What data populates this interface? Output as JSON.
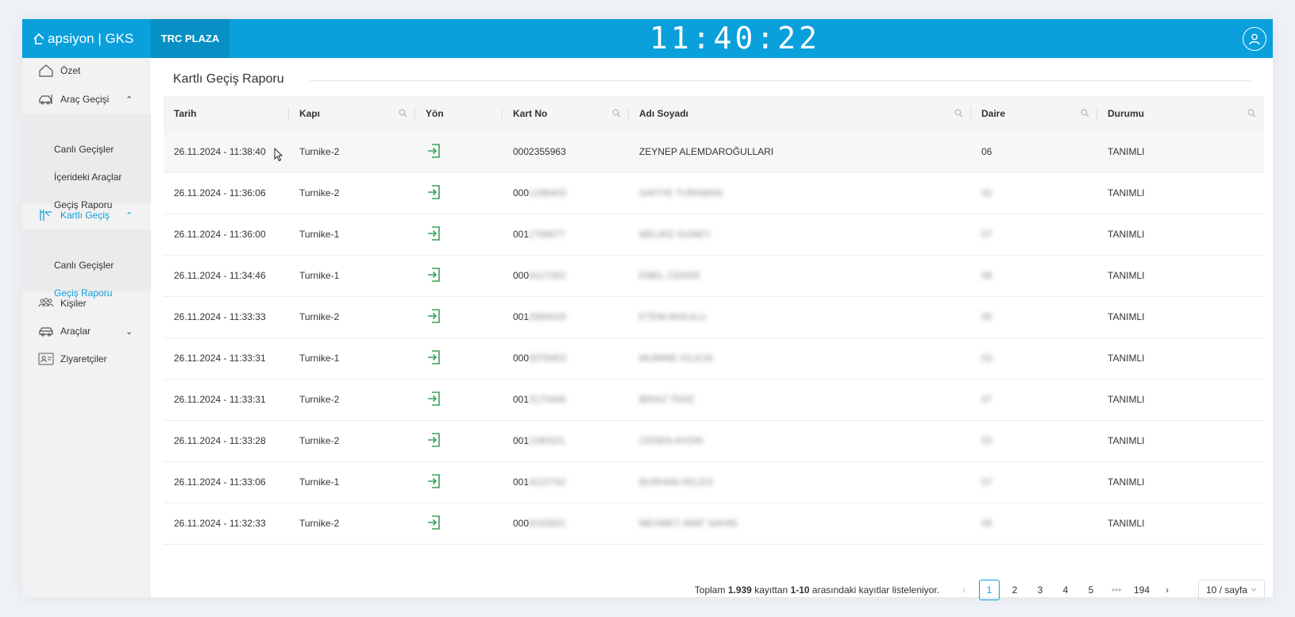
{
  "header": {
    "brand": "apsiyon | GKS",
    "site": "TRC PLAZA",
    "clock": "11:40:22"
  },
  "sidebar": {
    "items": [
      {
        "label": "Özet",
        "icon": "home-icon"
      },
      {
        "label": "Araç Geçişi",
        "icon": "car-gate-icon",
        "chevron": "⌃"
      },
      {
        "label": "Kartlı Geçiş",
        "icon": "turnstile-icon",
        "chevron": "⌃"
      },
      {
        "label": "Kişiler",
        "icon": "people-icon"
      },
      {
        "label": "Araçlar",
        "icon": "car-icon",
        "chevron": "⌄"
      },
      {
        "label": "Ziyaretçiler",
        "icon": "visitor-card-icon"
      }
    ],
    "arac_sub": [
      "Canlı Geçişler",
      "İçerideki Araçlar",
      "Geçiş Raporu"
    ],
    "kartli_sub": [
      "Canlı Geçişler",
      "Geçiş Raporu"
    ]
  },
  "page": {
    "title": "Kartlı Geçiş Raporu"
  },
  "table": {
    "columns": [
      "Tarih",
      "Kapı",
      "Yön",
      "Kart No",
      "Adı Soyadı",
      "Daire",
      "Durumu"
    ],
    "rows": [
      {
        "tarih": "26.11.2024 - 11:38:40",
        "kapi": "Turnike-2",
        "kart_prefix": "0002355963",
        "kart_rest": "",
        "ad": "ZEYNEP ALEMDAROĞULLARI",
        "daire": "06",
        "durum": "TANIMLI",
        "visible": true
      },
      {
        "tarih": "26.11.2024 - 11:36:06",
        "kapi": "Turnike-2",
        "kart_prefix": "000",
        "kart_rest": "1296403",
        "ad": "SAFIYE TURAMAN",
        "daire": "02",
        "durum": "TANIMLI",
        "visible": false
      },
      {
        "tarih": "26.11.2024 - 11:36:00",
        "kapi": "Turnike-1",
        "kart_prefix": "001",
        "kart_rest": "1708877",
        "ad": "MELIKE GUNEY",
        "daire": "07",
        "durum": "TANIMLI",
        "visible": false
      },
      {
        "tarih": "26.11.2024 - 11:34:46",
        "kapi": "Turnike-1",
        "kart_prefix": "000",
        "kart_rest": "8117263",
        "ad": "EMEL CEKER",
        "daire": "08",
        "durum": "TANIMLI",
        "visible": false
      },
      {
        "tarih": "26.11.2024 - 11:33:33",
        "kapi": "Turnike-2",
        "kart_prefix": "001",
        "kart_rest": "2560433",
        "ad": "ETEM AKKULU",
        "daire": "05",
        "durum": "TANIMLI",
        "visible": false
      },
      {
        "tarih": "26.11.2024 - 11:33:31",
        "kapi": "Turnike-1",
        "kart_prefix": "000",
        "kart_rest": "9376403",
        "ad": "MUMINE KILICAI",
        "daire": "03",
        "durum": "TANIMLI",
        "visible": false
      },
      {
        "tarih": "26.11.2024 - 11:33:31",
        "kapi": "Turnike-2",
        "kart_prefix": "001",
        "kart_rest": "3170405",
        "ad": "BIRAZ TEKE",
        "daire": "07",
        "durum": "TANIMLI",
        "visible": false
      },
      {
        "tarih": "26.11.2024 - 11:33:28",
        "kapi": "Turnike-2",
        "kart_prefix": "001",
        "kart_rest": "1280321",
        "ad": "CEREN AYDIN",
        "daire": "03",
        "durum": "TANIMLI",
        "visible": false
      },
      {
        "tarih": "26.11.2024 - 11:33:06",
        "kapi": "Turnike-1",
        "kart_prefix": "001",
        "kart_rest": "4122742",
        "ad": "BURHAN KELES",
        "daire": "07",
        "durum": "TANIMLI",
        "visible": false
      },
      {
        "tarih": "26.11.2024 - 11:32:33",
        "kapi": "Turnike-2",
        "kart_prefix": "000",
        "kart_rest": "8163601",
        "ad": "MEHMET AMIF SAHIN",
        "daire": "09",
        "durum": "TANIMLI",
        "visible": false
      }
    ]
  },
  "pagination": {
    "total_prefix": "Toplam ",
    "total_count": "1.939",
    "total_mid": " kayıttan ",
    "range": "1-10",
    "total_suffix": " arasındaki kayıtlar listeleniyor.",
    "prev": "‹",
    "pages": [
      "1",
      "2",
      "3",
      "4",
      "5"
    ],
    "ellipsis": "•••",
    "last": "194",
    "next": "›",
    "page_size": "10 / sayfa",
    "current": "1"
  },
  "colors": {
    "brand": "#0aa0dc",
    "site_bg": "#0790c6",
    "direction_in": "#3aa05a"
  }
}
